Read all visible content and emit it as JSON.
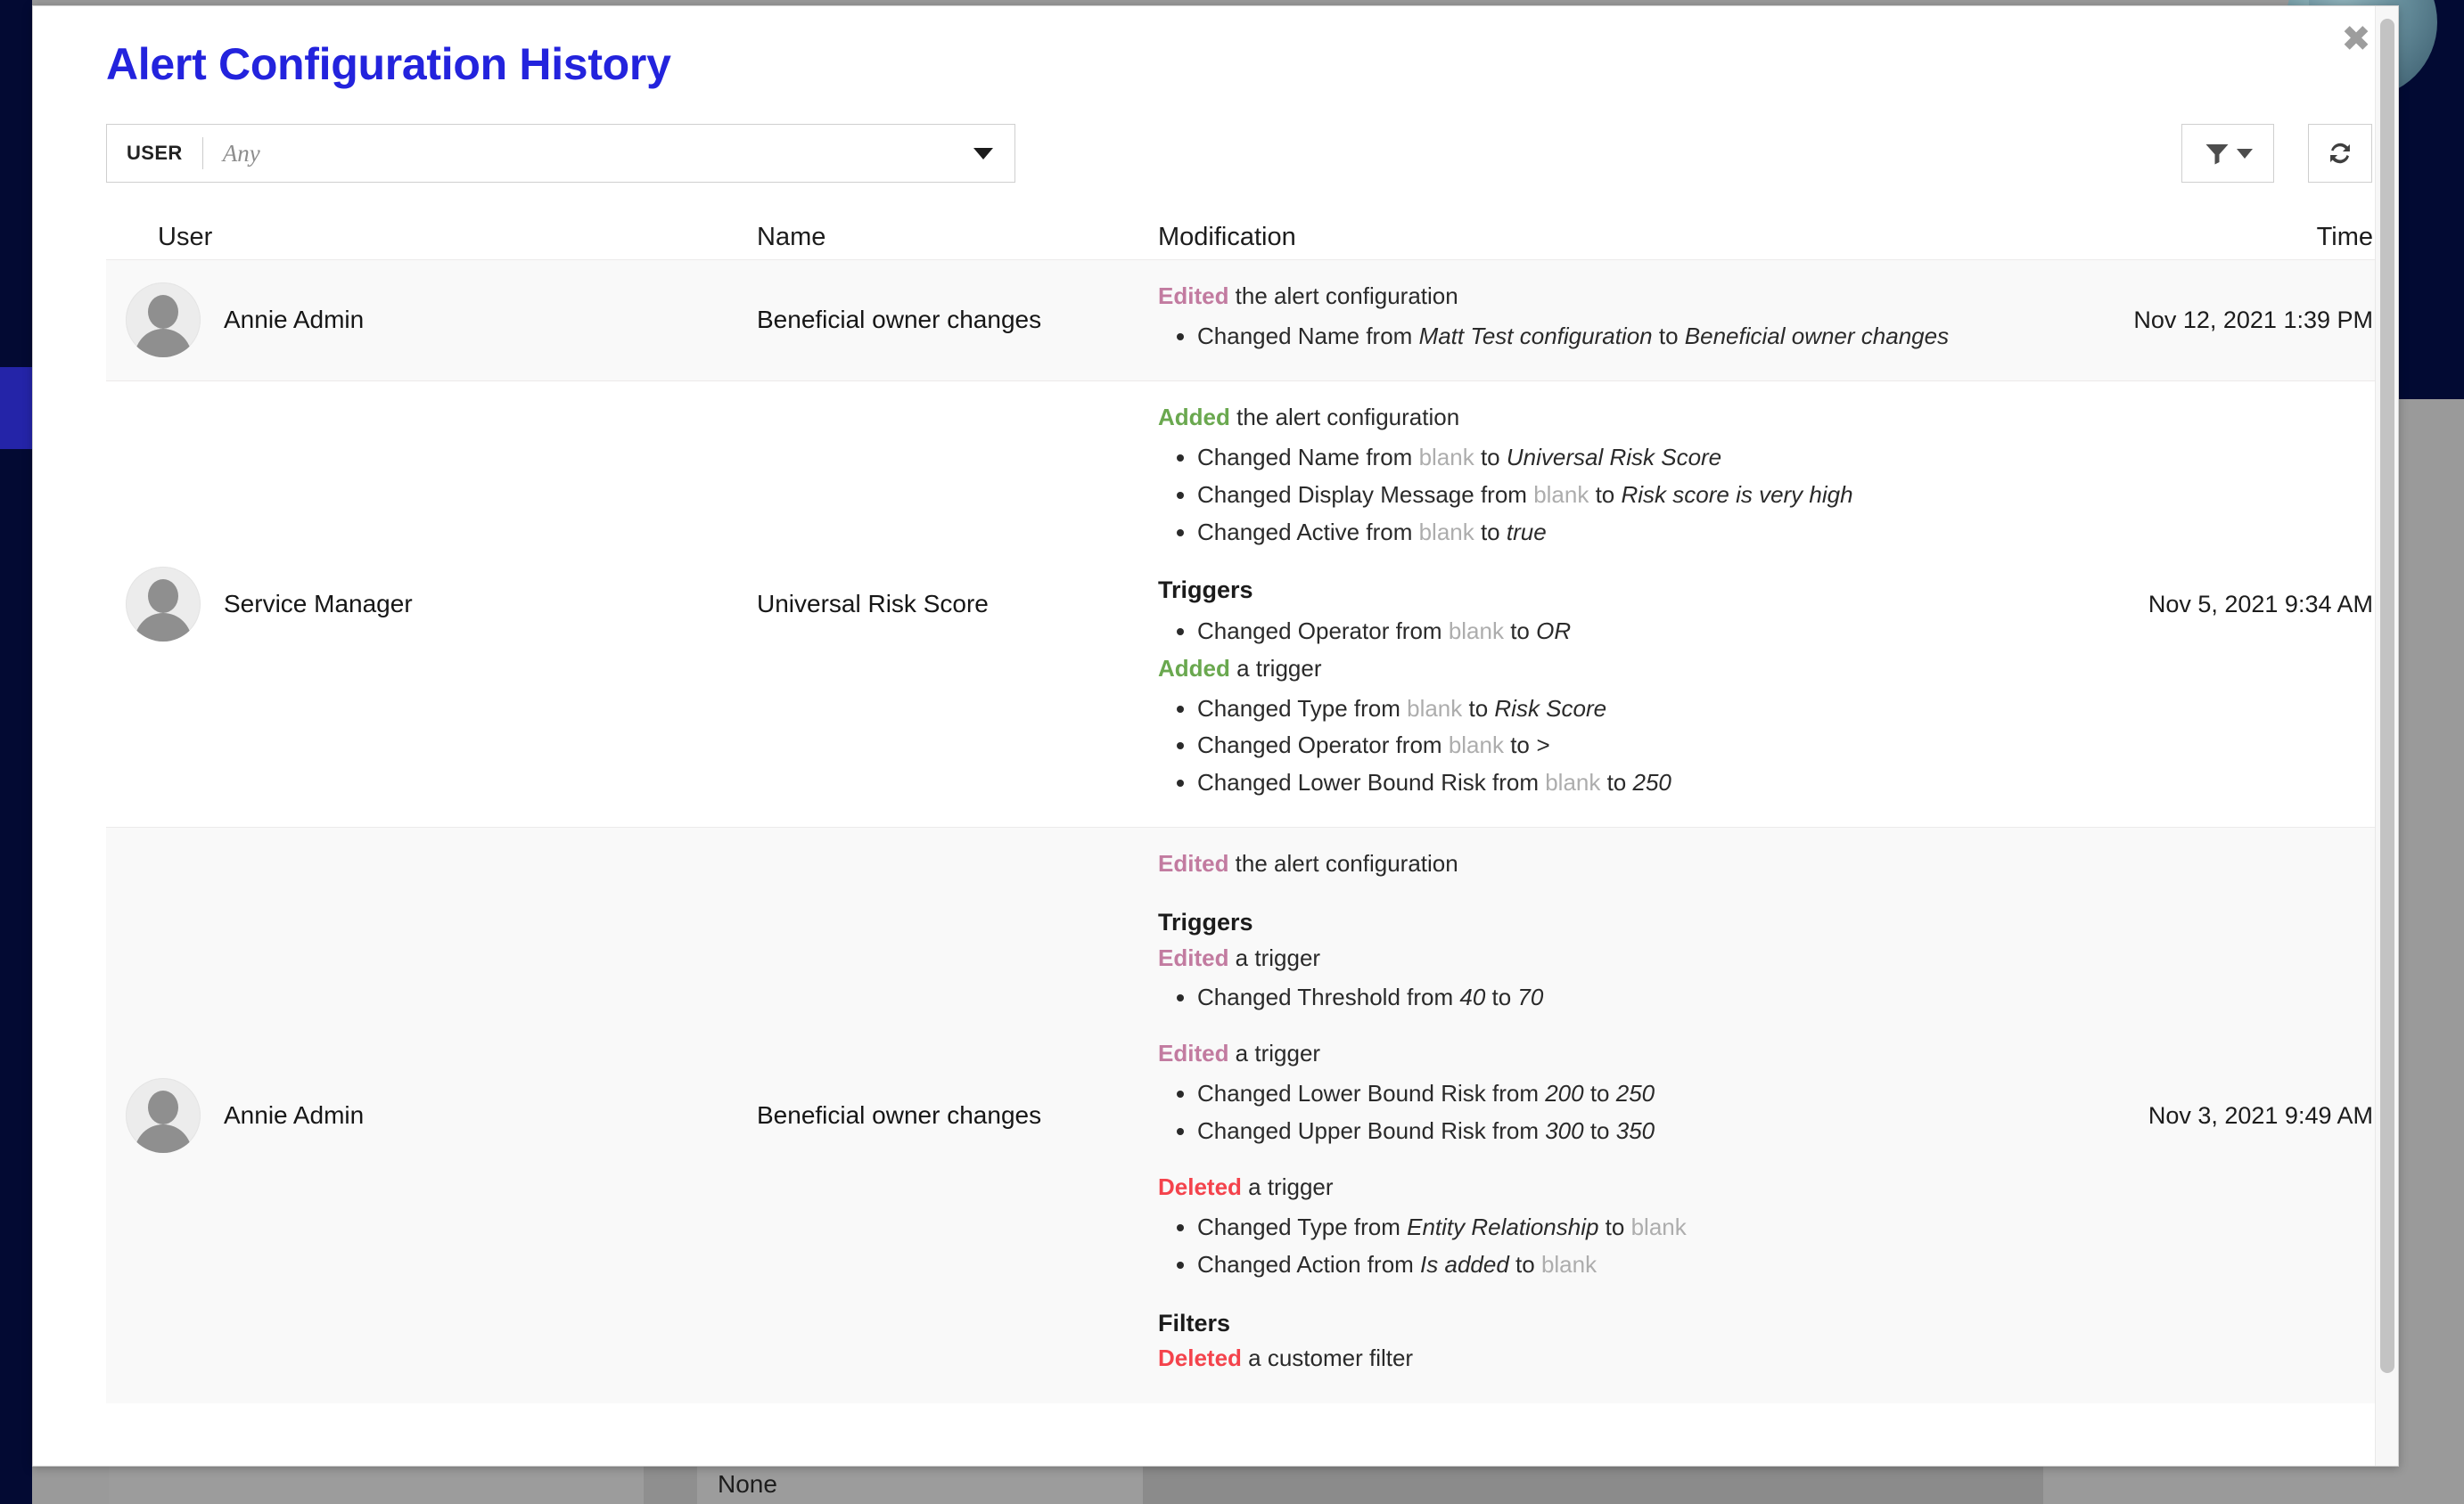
{
  "modal": {
    "title": "Alert Configuration History",
    "close_label": "✖"
  },
  "filter_bar": {
    "user_select": {
      "label": "USER",
      "value": "Any",
      "placeholder": "Any"
    },
    "filter_button_name": "filter-icon",
    "refresh_button_name": "refresh-icon"
  },
  "table": {
    "columns": {
      "user": "User",
      "name": "Name",
      "modification": "Modification",
      "time": "Time"
    },
    "rows": [
      {
        "user": "Annie Admin",
        "name": "Beneficial owner changes",
        "time": "Nov 12, 2021 1:39 PM",
        "blocks": [
          {
            "kind": "action",
            "keyword": "Edited",
            "keyword_class": "edited",
            "text": " the alert configuration",
            "items": [
              {
                "prefix": "Changed Name from ",
                "from": "Matt Test configuration",
                "from_blank": false,
                "mid": " to ",
                "to": "Beneficial owner changes",
                "to_blank": false
              }
            ]
          }
        ]
      },
      {
        "user": "Service Manager",
        "name": "Universal Risk Score",
        "time": "Nov 5, 2021 9:34 AM",
        "blocks": [
          {
            "kind": "action",
            "keyword": "Added",
            "keyword_class": "added",
            "text": " the alert configuration",
            "items": [
              {
                "prefix": "Changed Name from ",
                "from": "blank",
                "from_blank": true,
                "mid": " to ",
                "to": "Universal Risk Score",
                "to_blank": false
              },
              {
                "prefix": "Changed Display Message from ",
                "from": "blank",
                "from_blank": true,
                "mid": " to ",
                "to": "Risk score is very high",
                "to_blank": false
              },
              {
                "prefix": "Changed Active from ",
                "from": "blank",
                "from_blank": true,
                "mid": " to ",
                "to": "true",
                "to_blank": false
              }
            ]
          },
          {
            "kind": "section",
            "title": "Triggers",
            "items": [
              {
                "prefix": "Changed Operator from ",
                "from": "blank",
                "from_blank": true,
                "mid": " to ",
                "to": "OR",
                "to_blank": false
              }
            ]
          },
          {
            "kind": "action",
            "keyword": "Added",
            "keyword_class": "added",
            "text": " a trigger",
            "items": [
              {
                "prefix": "Changed Type from ",
                "from": "blank",
                "from_blank": true,
                "mid": " to ",
                "to": "Risk Score",
                "to_blank": false
              },
              {
                "prefix": "Changed Operator from ",
                "from": "blank",
                "from_blank": true,
                "mid": " to ",
                "to": ">",
                "to_blank": false
              },
              {
                "prefix": "Changed Lower Bound Risk from ",
                "from": "blank",
                "from_blank": true,
                "mid": " to ",
                "to": "250",
                "to_blank": false
              }
            ]
          }
        ]
      },
      {
        "user": "Annie Admin",
        "name": "Beneficial owner changes",
        "time": "Nov 3, 2021 9:49 AM",
        "blocks": [
          {
            "kind": "action",
            "keyword": "Edited",
            "keyword_class": "edited",
            "text": " the alert configuration",
            "items": []
          },
          {
            "kind": "section",
            "title": "Triggers",
            "items": []
          },
          {
            "kind": "action",
            "keyword": "Edited",
            "keyword_class": "edited",
            "text": " a trigger",
            "items": [
              {
                "prefix": "Changed Threshold from ",
                "from": "40",
                "from_blank": false,
                "mid": " to ",
                "to": "70",
                "to_blank": false
              }
            ]
          },
          {
            "kind": "action",
            "keyword": "Edited",
            "keyword_class": "edited",
            "text": " a trigger",
            "items": [
              {
                "prefix": "Changed Lower Bound Risk from ",
                "from": "200",
                "from_blank": false,
                "mid": " to ",
                "to": "250",
                "to_blank": false
              },
              {
                "prefix": "Changed Upper Bound Risk from ",
                "from": "300",
                "from_blank": false,
                "mid": " to ",
                "to": "350",
                "to_blank": false
              }
            ]
          },
          {
            "kind": "action",
            "keyword": "Deleted",
            "keyword_class": "deleted",
            "text": " a trigger",
            "items": [
              {
                "prefix": "Changed Type from ",
                "from": "Entity Relationship",
                "from_blank": false,
                "mid": " to ",
                "to": "blank",
                "to_blank": true
              },
              {
                "prefix": "Changed Action from ",
                "from": "Is added",
                "from_blank": false,
                "mid": " to ",
                "to": "blank",
                "to_blank": true
              }
            ]
          },
          {
            "kind": "section",
            "title": "Filters",
            "items": []
          },
          {
            "kind": "action",
            "keyword": "Deleted",
            "keyword_class": "deleted",
            "text": " a customer filter",
            "items": []
          }
        ]
      }
    ]
  },
  "background": {
    "none_label": "None"
  },
  "colors": {
    "title": "#2323dd",
    "edited": "#c27ba0",
    "added": "#6aa84f",
    "deleted": "#f4434c",
    "blank": "#adadad",
    "rail": "#030a33",
    "rail_active": "#2424a8"
  }
}
